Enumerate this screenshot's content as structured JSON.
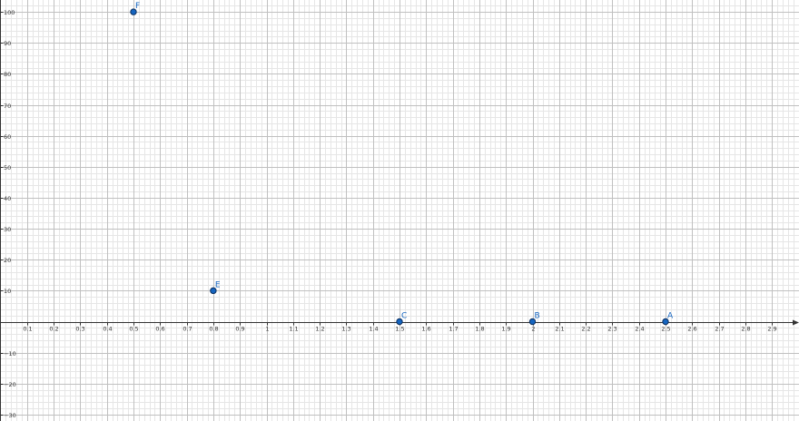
{
  "chart_data": {
    "type": "scatter",
    "title": "",
    "xlabel": "",
    "ylabel": "",
    "xlim": [
      0,
      3.0
    ],
    "ylim": [
      -31,
      101
    ],
    "grid": true,
    "x_ticks": [
      "0.1",
      "0.2",
      "0.3",
      "0.4",
      "0.5",
      "0.6",
      "0.7",
      "0.8",
      "0.9",
      "1",
      "1.1",
      "1.2",
      "1.3",
      "1.4",
      "1.5",
      "1.6",
      "1.7",
      "1.8",
      "1.9",
      "2",
      "2.1",
      "2.2",
      "2.3",
      "2.4",
      "2.5",
      "2.6",
      "2.7",
      "2.8",
      "2.9"
    ],
    "y_ticks": [
      "100",
      "90",
      "80",
      "70",
      "60",
      "50",
      "40",
      "30",
      "20",
      "10",
      "−10",
      "−20",
      "−30"
    ],
    "points": [
      {
        "name": "A",
        "x": 2.5,
        "y": 0
      },
      {
        "name": "B",
        "x": 2.0,
        "y": 0
      },
      {
        "name": "C",
        "x": 1.5,
        "y": 0
      },
      {
        "name": "E",
        "x": 0.8,
        "y": 10
      },
      {
        "name": "F",
        "x": 0.5,
        "y": 100
      }
    ]
  },
  "colors": {
    "point_fill": "#1565c0",
    "point_stroke": "#0d2f5e",
    "label": "#1565c0",
    "axis": "#333333",
    "major_grid": "#c0c0c0",
    "minor_grid": "#e6e6e6"
  }
}
